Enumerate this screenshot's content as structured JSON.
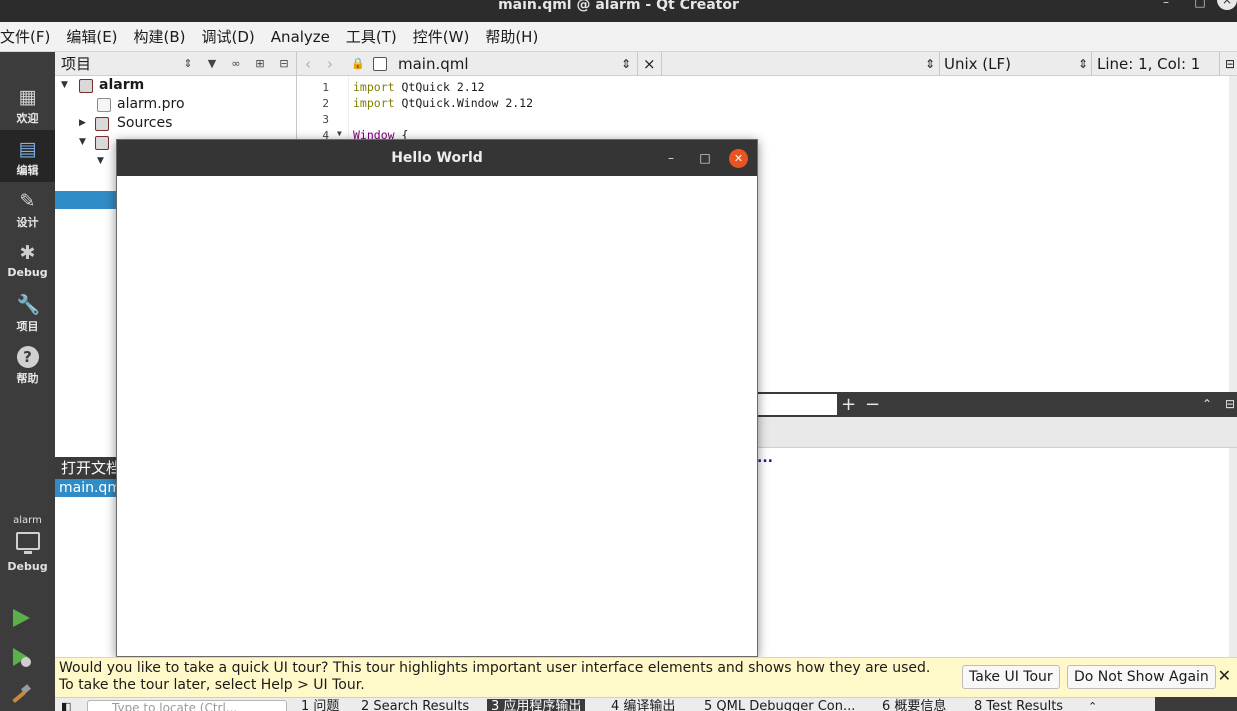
{
  "window": {
    "title": "main.qml @ alarm - Qt Creator",
    "controls": [
      "–",
      "□",
      "×"
    ]
  },
  "menu": [
    "文件(F)",
    "编辑(E)",
    "构建(B)",
    "调试(D)",
    "Analyze",
    "工具(T)",
    "控件(W)",
    "帮助(H)"
  ],
  "modes": [
    {
      "label": "欢迎",
      "icon": "grid-icon",
      "glyph": "▦"
    },
    {
      "label": "编辑",
      "icon": "edit-icon",
      "glyph": "▤"
    },
    {
      "label": "设计",
      "icon": "pencil-icon",
      "glyph": "✎"
    },
    {
      "label": "Debug",
      "icon": "bug-icon",
      "glyph": "✱"
    },
    {
      "label": "项目",
      "icon": "wrench-icon",
      "glyph": "🔧"
    },
    {
      "label": "帮助",
      "icon": "help-icon",
      "glyph": "?"
    }
  ],
  "kit": {
    "project": "alarm",
    "config": "Debug"
  },
  "project_panel": {
    "title": "项目",
    "tree": [
      {
        "label": "alarm",
        "bold": true
      },
      {
        "label": "alarm.pro"
      },
      {
        "label": "Sources"
      }
    ]
  },
  "open_documents": {
    "title": "打开文档",
    "items": [
      "main.qml"
    ]
  },
  "editor": {
    "file": "main.qml",
    "line_ending": "Unix (LF)",
    "cursor": "Line: 1, Col: 1",
    "lines": [
      {
        "num": "1",
        "kw": "import",
        "rest": " QtQuick 2.12"
      },
      {
        "num": "2",
        "kw": "import",
        "rest": " QtQuick.Window 2.12"
      },
      {
        "num": "3",
        "kw": "",
        "rest": ""
      },
      {
        "num": "4",
        "kw": "Window",
        "rest": " {"
      }
    ]
  },
  "app_window": {
    "title": "Hello World"
  },
  "output": {
    "dots": "..."
  },
  "tour": {
    "message": "Would you like to take a quick UI tour? This tour highlights important user interface elements and shows how they are used. To take the tour later, select Help > UI Tour.",
    "take_label": "Take UI Tour",
    "dismiss_label": "Do Not Show Again"
  },
  "statusbar": {
    "locate_placeholder": "Type to locate (Ctrl...",
    "tabs": [
      "1 问题",
      "2 Search Results",
      "3 应用程序输出",
      "4 编译输出",
      "5 QML Debugger Con...",
      "6 概要信息",
      "8 Test Results"
    ],
    "active_tab": 2
  },
  "colors": {
    "accent": "#308cc6",
    "close_orange": "#e95420",
    "dark": "#3c3c3c",
    "tour_bg": "#fff8c8"
  }
}
